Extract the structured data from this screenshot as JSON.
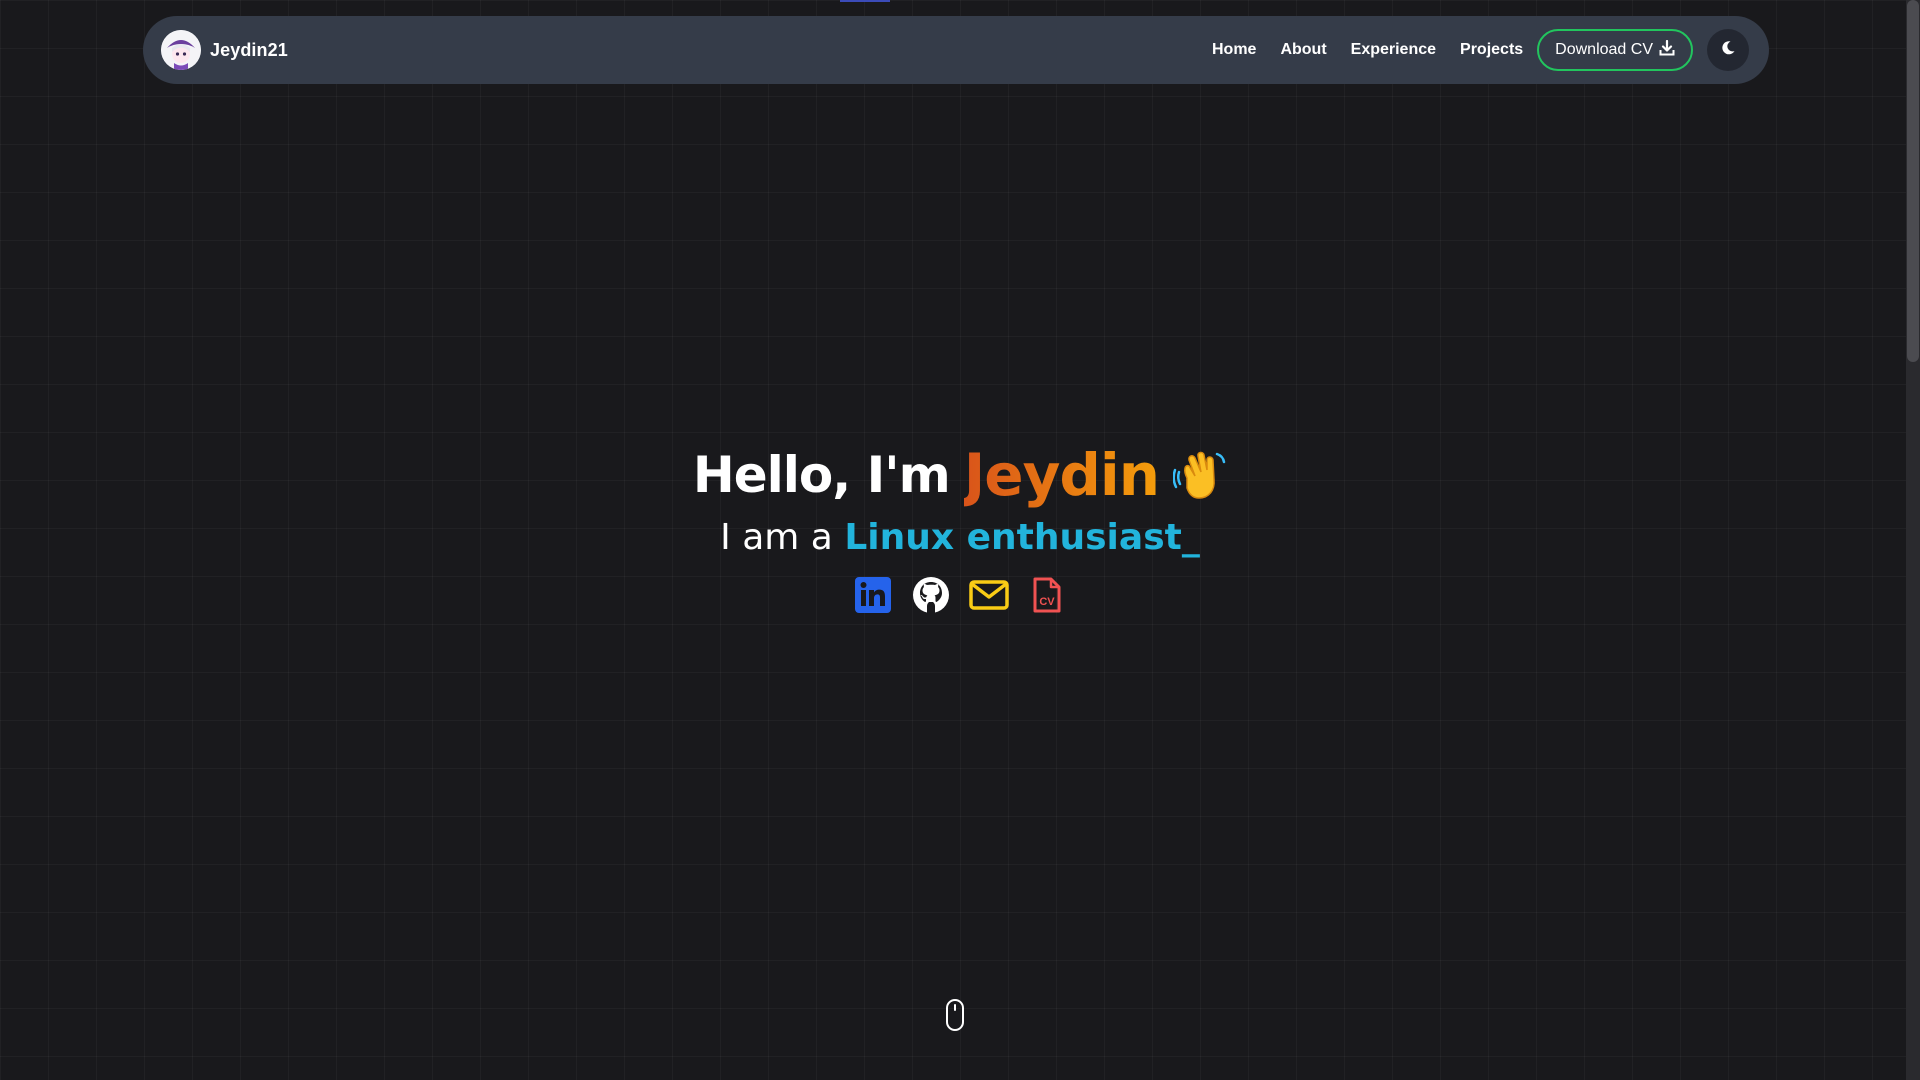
{
  "navbar": {
    "brand": "Jeydin21",
    "links": [
      "Home",
      "About",
      "Experience",
      "Projects"
    ],
    "download_label": "Download CV",
    "download_icon": "download-icon",
    "theme_icon": "moon-icon"
  },
  "hero": {
    "greeting": "Hello, I'm",
    "name": "Jeydin",
    "wave_icon": "waving-hand-icon",
    "subtitle_prefix": "I am a",
    "role": "Linux enthusiast",
    "cursor": "_"
  },
  "socials": [
    {
      "icon": "linkedin-icon",
      "color": "#2563eb"
    },
    {
      "icon": "github-icon",
      "color": "#ffffff"
    },
    {
      "icon": "mail-icon",
      "color": "#facc15"
    },
    {
      "icon": "cv-file-icon",
      "color": "#f05252"
    }
  ],
  "colors": {
    "background": "#19191c",
    "navbar": "#353c49",
    "accent_green": "#22c55e",
    "name_gradient_start": "#d9541a",
    "name_gradient_end": "#f59e0b",
    "role": "#22b4dc"
  },
  "scroll_indicator_icon": "mouse-icon"
}
